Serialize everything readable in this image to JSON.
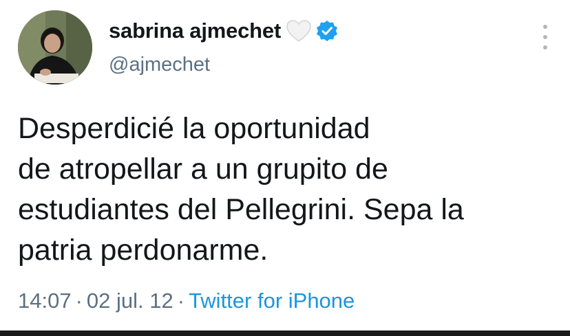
{
  "author": {
    "display_name": "sabrina ajmechet",
    "handle": "@ajmechet",
    "verified": true,
    "badge_icon": "white-heart-icon",
    "verified_icon": "verified-badge-icon"
  },
  "tweet": {
    "text": "Desperdicié la oportunidad\nde atropellar a un grupito de\nestudiantes del Pellegrini. Sepa la\npatria perdonarme."
  },
  "meta": {
    "time": "14:07",
    "date": "02 jul. 12",
    "separator": "·",
    "source": "Twitter for iPhone"
  },
  "colors": {
    "text": "#14171a",
    "secondary": "#5b7083",
    "link": "#1b95e0",
    "verified": "#1da1f2"
  }
}
